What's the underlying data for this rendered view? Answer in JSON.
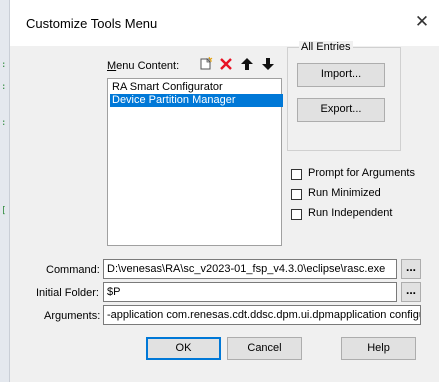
{
  "window": {
    "title": "Customize Tools Menu",
    "close_glyph": "✕"
  },
  "menu_content": {
    "label": "Menu Content:",
    "items": [
      {
        "label": "RA Smart Configurator",
        "selected": false
      },
      {
        "label": "Device Partition Manager",
        "selected": true
      }
    ],
    "toolbar": [
      {
        "name": "new-item-icon"
      },
      {
        "name": "delete-icon"
      },
      {
        "name": "move-up-icon"
      },
      {
        "name": "move-down-icon"
      }
    ]
  },
  "all_entries": {
    "label": "All Entries",
    "import_label": "Import...",
    "export_label": "Export..."
  },
  "options": {
    "prompt_args": {
      "label": "Prompt for Arguments",
      "checked": false
    },
    "run_minimized": {
      "label": "Run Minimized",
      "checked": false
    },
    "run_independent": {
      "label": "Run Independent",
      "checked": false
    }
  },
  "fields": {
    "command": {
      "label": "Command:",
      "value": "D:\\venesas\\RA\\sc_v2023-01_fsp_v4.3.0\\eclipse\\rasc.exe",
      "browse": "..."
    },
    "initial_folder": {
      "label": "Initial Folder:",
      "value": "$P",
      "browse": "..."
    },
    "arguments": {
      "label": "Arguments:",
      "value": "-application com.renesas.cdt.ddsc.dpm.ui.dpmapplication configura"
    }
  },
  "buttons": {
    "ok": "OK",
    "cancel": "Cancel",
    "help": "Help"
  },
  "colors": {
    "selection": "#0078d7",
    "delete_icon": "#e81123",
    "dialog_bg": "#f0f0f0"
  }
}
